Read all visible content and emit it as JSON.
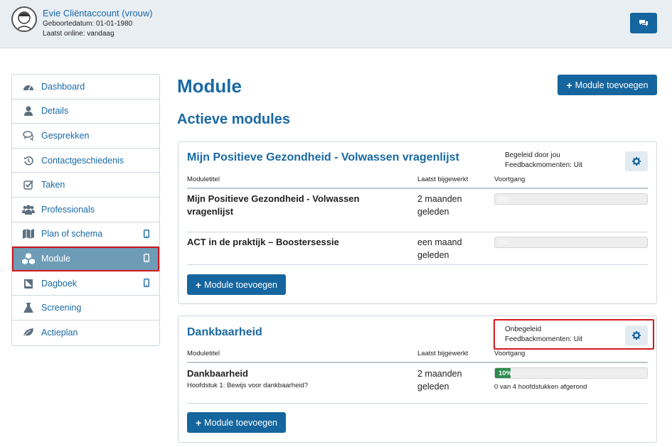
{
  "client": {
    "name": "Evie Cliëntaccount (vrouw)",
    "dob": "Geboortedatum: 01-01-1980",
    "last_online": "Laatst online: vandaag"
  },
  "colors": {
    "primary": "#15659e",
    "link": "#1a69a4",
    "active_nav": "#6e9cb7",
    "highlight": "#d0191f",
    "progress": "#2e8b4f"
  },
  "sidebar": {
    "items": [
      {
        "label": "Dashboard",
        "icon": "dashboard-icon"
      },
      {
        "label": "Details",
        "icon": "user-icon"
      },
      {
        "label": "Gesprekken",
        "icon": "chat-bubbles-icon"
      },
      {
        "label": "Contactgeschiedenis",
        "icon": "history-icon"
      },
      {
        "label": "Taken",
        "icon": "checkbox-icon"
      },
      {
        "label": "Professionals",
        "icon": "group-icon"
      },
      {
        "label": "Plan of schema",
        "icon": "map-icon",
        "mobile": true
      },
      {
        "label": "Module",
        "icon": "cubes-icon",
        "mobile": true,
        "active": true
      },
      {
        "label": "Dagboek",
        "icon": "book-icon",
        "mobile": true
      },
      {
        "label": "Screening",
        "icon": "flask-icon"
      },
      {
        "label": "Actieplan",
        "icon": "leaf-icon"
      }
    ]
  },
  "main": {
    "title": "Module",
    "add_button": "Module toevoegen",
    "section_title": "Actieve modules",
    "columns": {
      "title": "Moduletitel",
      "updated": "Laatst bijgewerkt",
      "progress": "Voortgang"
    },
    "panels": [
      {
        "title": "Mijn Positieve Gezondheid - Volwassen vragenlijst",
        "guidance": "Begeleid door jou",
        "feedback": "Feedbackmomenten: Uit",
        "add_button": "Module toevoegen",
        "rows": [
          {
            "title_line1": "Mijn Positieve Gezondheid - Volwassen",
            "title_line2": "vragenlijst",
            "updated_line1": "2 maanden",
            "updated_line2": "geleden",
            "progress": 0,
            "progress_label": "0%"
          },
          {
            "title_line1": "ACT in de praktijk – Boostersessie",
            "updated_line1": "een maand",
            "updated_line2": "geleden",
            "progress": 0,
            "progress_label": "0%"
          }
        ]
      },
      {
        "title": "Dankbaarheid",
        "guidance": "Onbegeleid",
        "feedback": "Feedbackmomenten: Uit",
        "add_button": "Module toevoegen",
        "rows": [
          {
            "title_line1": "Dankbaarheid",
            "subtitle": "Hoofdstuk 1: Bewijs voor dankbaarheid?",
            "updated_line1": "2 maanden",
            "updated_line2": "geleden",
            "progress": 10,
            "progress_label": "10%",
            "progress_note": "0 van 4 hoofdstukken afgerond"
          }
        ]
      }
    ]
  }
}
